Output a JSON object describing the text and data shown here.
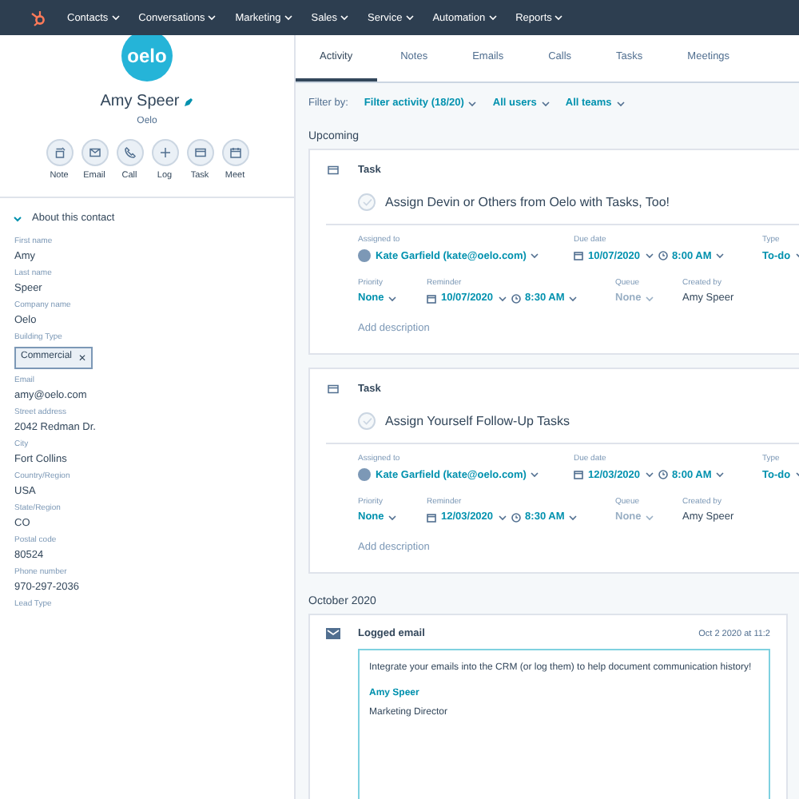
{
  "nav": {
    "items": [
      "Contacts",
      "Conversations",
      "Marketing",
      "Sales",
      "Service",
      "Automation",
      "Reports"
    ]
  },
  "contact": {
    "logo_text": "oelo",
    "name": "Amy Speer",
    "company": "Oelo",
    "actions": [
      {
        "label": "Note",
        "kind": "note"
      },
      {
        "label": "Email",
        "kind": "email"
      },
      {
        "label": "Call",
        "kind": "call"
      },
      {
        "label": "Log",
        "kind": "log"
      },
      {
        "label": "Task",
        "kind": "task"
      },
      {
        "label": "Meet",
        "kind": "meet"
      }
    ],
    "section": {
      "title": "About this contact",
      "expanded": true
    },
    "fields": [
      {
        "label": "First name",
        "value": "Amy",
        "kind": "text"
      },
      {
        "label": "Last name",
        "value": "Speer",
        "kind": "text"
      },
      {
        "label": "Company name",
        "value": "Oelo",
        "kind": "text"
      },
      {
        "label": "Building Type",
        "value": "Commercial",
        "kind": "tag",
        "remove": "✕"
      },
      {
        "label": "Email",
        "value": "amy@oelo.com",
        "kind": "text"
      },
      {
        "label": "Street address",
        "value": "2042 Redman Dr.",
        "kind": "text"
      },
      {
        "label": "City",
        "value": "Fort Collins",
        "kind": "text"
      },
      {
        "label": "Country/Region",
        "value": "USA",
        "kind": "text"
      },
      {
        "label": "State/Region",
        "value": "CO",
        "kind": "text"
      },
      {
        "label": "Postal code",
        "value": "80524",
        "kind": "text"
      },
      {
        "label": "Phone number",
        "value": "970-297-2036",
        "kind": "text"
      },
      {
        "label": "Lead Type",
        "kind": "text"
      }
    ]
  },
  "tabs": [
    {
      "label": "Activity",
      "selected": true
    },
    {
      "label": "Notes",
      "selected": false
    },
    {
      "label": "Emails",
      "selected": false
    },
    {
      "label": "Calls",
      "selected": false
    },
    {
      "label": "Tasks",
      "selected": false
    },
    {
      "label": "Meetings",
      "selected": false
    }
  ],
  "filter": {
    "label": "Filter by:",
    "options": [
      "Filter activity (18/20)",
      "All users",
      "All teams"
    ]
  },
  "upcoming": {
    "heading": "Upcoming",
    "tasks": [
      {
        "type_label": "Task",
        "title": "Assign Devin or Others from Oelo with Tasks, Too!",
        "completed": false,
        "assigned_label": "Assigned to",
        "assigned": "Kate Garfield (kate@oelo.com)",
        "due_label": "Due date",
        "due_date": "10/07/2020",
        "due_time": "8:00 AM",
        "type_field_label": "Type",
        "type": "To-do",
        "priority_label": "Priority",
        "priority": "None",
        "reminder_label": "Reminder",
        "reminder_date": "10/07/2020",
        "reminder_time": "8:30 AM",
        "queue_label": "Queue",
        "queue": "None",
        "created_label": "Created by",
        "created_by": "Amy Speer",
        "add_description": "Add description"
      },
      {
        "type_label": "Task",
        "title": "Assign Yourself Follow-Up Tasks",
        "completed": false,
        "assigned_label": "Assigned to",
        "assigned": "Kate Garfield (kate@oelo.com)",
        "due_label": "Due date",
        "due_date": "12/03/2020",
        "due_time": "8:00 AM",
        "type_field_label": "Type",
        "type": "To-do",
        "priority_label": "Priority",
        "priority": "None",
        "reminder_label": "Reminder",
        "reminder_date": "12/03/2020",
        "reminder_time": "8:30 AM",
        "queue_label": "Queue",
        "queue": "None",
        "created_label": "Created by",
        "created_by": "Amy Speer",
        "add_description": "Add description"
      }
    ]
  },
  "month": {
    "heading": "October 2020",
    "email": {
      "type_label": "Logged email",
      "date": "Oct 2 2020 at 11:2",
      "body": "Integrate your emails into the CRM (or log them) to help document communication history!",
      "signature_name": "Amy Speer",
      "signature_title": "Marketing Director"
    }
  }
}
